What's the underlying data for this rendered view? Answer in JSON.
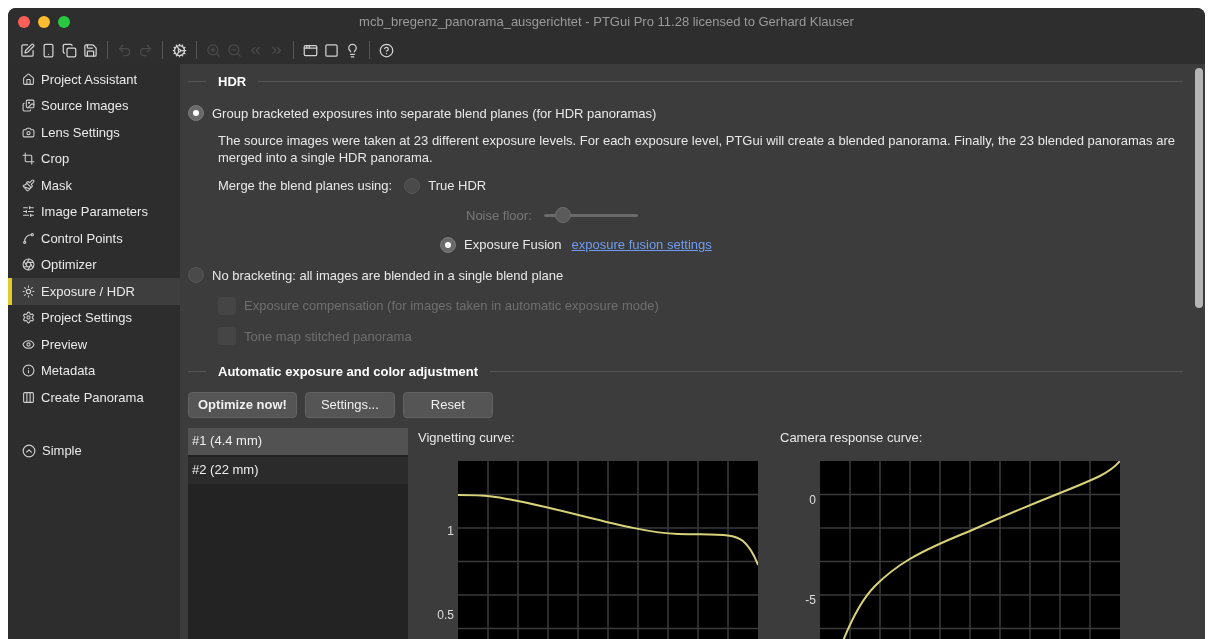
{
  "window": {
    "title": "mcb_bregenz_panorama_ausgerichtet - PTGui Pro 11.28 licensed to Gerhard Klauser"
  },
  "toolbar": [
    {
      "kind": "edit",
      "disabled": false
    },
    {
      "kind": "card",
      "disabled": false
    },
    {
      "kind": "copy",
      "disabled": false
    },
    {
      "kind": "save",
      "disabled": false
    },
    {
      "kind": "separator"
    },
    {
      "kind": "undo",
      "disabled": true
    },
    {
      "kind": "redo",
      "disabled": true
    },
    {
      "kind": "separator"
    },
    {
      "kind": "gear",
      "disabled": false
    },
    {
      "kind": "separator"
    },
    {
      "kind": "zoom-in",
      "disabled": true
    },
    {
      "kind": "zoom-out",
      "disabled": true
    },
    {
      "kind": "prev",
      "disabled": true
    },
    {
      "kind": "next",
      "disabled": true
    },
    {
      "kind": "separator"
    },
    {
      "kind": "windows",
      "disabled": false
    },
    {
      "kind": "panel",
      "disabled": false
    },
    {
      "kind": "bulb",
      "disabled": false
    },
    {
      "kind": "separator"
    },
    {
      "kind": "help",
      "disabled": false
    }
  ],
  "sidebar": {
    "items": [
      {
        "label": "Project Assistant",
        "selected": false
      },
      {
        "label": "Source Images",
        "selected": false
      },
      {
        "label": "Lens Settings",
        "selected": false
      },
      {
        "label": "Crop",
        "selected": false
      },
      {
        "label": "Mask",
        "selected": false
      },
      {
        "label": "Image Parameters",
        "selected": false
      },
      {
        "label": "Control Points",
        "selected": false
      },
      {
        "label": "Optimizer",
        "selected": false
      },
      {
        "label": "Exposure / HDR",
        "selected": true
      },
      {
        "label": "Project Settings",
        "selected": false
      },
      {
        "label": "Preview",
        "selected": false
      },
      {
        "label": "Metadata",
        "selected": false
      },
      {
        "label": "Create Panorama",
        "selected": false
      }
    ],
    "mode_button": {
      "label": "Simple"
    }
  },
  "hdr": {
    "heading": "HDR",
    "group_option": {
      "label": "Group bracketed exposures into separate blend planes (for HDR panoramas)",
      "selected": true
    },
    "description": "The source images were taken at 23 different exposure levels. For each exposure level, PTGui will create a blended panorama. Finally, the 23 blended panoramas are merged into a single HDR panorama.",
    "merge_label": "Merge the blend planes using:",
    "true_hdr": {
      "label": "True HDR",
      "selected": false
    },
    "noise_floor": {
      "label": "Noise floor:",
      "level": 0.15,
      "disabled": true
    },
    "exposure_fusion": {
      "label": "Exposure Fusion",
      "selected": true
    },
    "fusion_settings_link": "exposure fusion settings",
    "no_bracketing_option": {
      "label": "No bracketing: all images are blended in a single blend plane",
      "selected": false
    },
    "checkboxes": [
      {
        "label": "Exposure compensation (for images taken in automatic exposure mode)",
        "checked": false,
        "disabled": true
      },
      {
        "label": "Tone map stitched panorama",
        "checked": false,
        "disabled": true
      }
    ]
  },
  "auto_adjust": {
    "heading": "Automatic exposure and color adjustment",
    "buttons": [
      {
        "label": "Optimize now!",
        "bold": true
      },
      {
        "label": "Settings...",
        "bold": false
      },
      {
        "label": "Reset",
        "bold": false
      }
    ],
    "lenses": [
      {
        "label": "#1 (4.4 mm)",
        "selected": true
      },
      {
        "label": "#2 (22 mm)",
        "selected": false
      }
    ],
    "vignetting_curve": {
      "label": "Vignetting curve:",
      "y_tick_labels": [
        "1",
        "0.5"
      ]
    },
    "response_curve": {
      "label": "Camera response curve:",
      "y_tick_labels": [
        "0",
        "-5"
      ]
    }
  }
}
